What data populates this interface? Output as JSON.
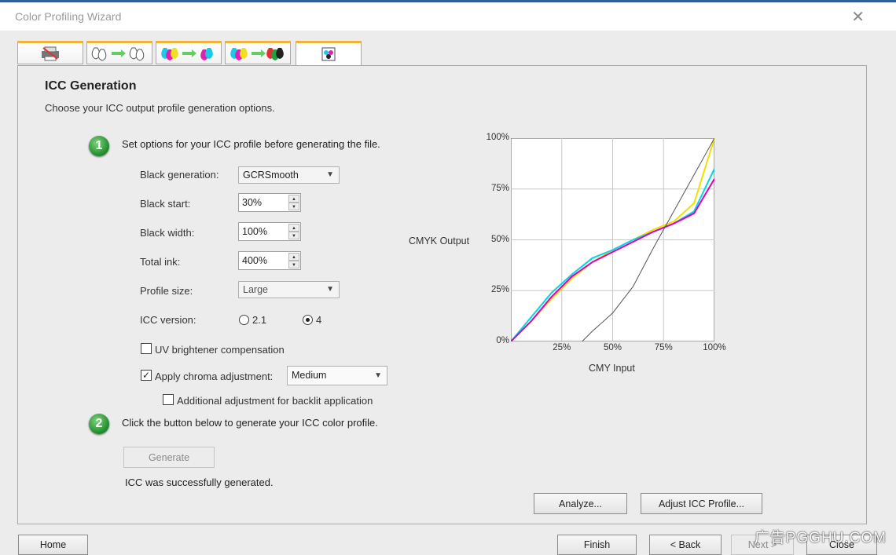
{
  "window": {
    "title": "Color Profiling Wizard"
  },
  "tabs": [
    {
      "icon": "printer-icon",
      "active": false
    },
    {
      "icon": "ink-to-ink-icon",
      "active": false
    },
    {
      "icon": "cmyk-to-ink-icon",
      "active": false
    },
    {
      "icon": "cmyk-to-cmyk-icon",
      "active": false
    },
    {
      "icon": "icc-profile-icon",
      "active": true
    }
  ],
  "header": {
    "title": "ICC Generation",
    "subtitle": "Choose your ICC output profile generation options."
  },
  "step1": {
    "number": "1",
    "text": "Set options for your ICC profile before generating the file."
  },
  "options": {
    "black_generation": {
      "label": "Black generation:",
      "value": "GCRSmooth"
    },
    "black_start": {
      "label": "Black start:",
      "value": "30%"
    },
    "black_width": {
      "label": "Black width:",
      "value": "100%"
    },
    "total_ink": {
      "label": "Total ink:",
      "value": "400%"
    },
    "profile_size": {
      "label": "Profile size:",
      "value": "Large"
    },
    "icc_version": {
      "label": "ICC version:",
      "options": [
        "2.1",
        "4"
      ],
      "selected": "4"
    },
    "uv_brightener": {
      "label": "UV brightener compensation",
      "checked": false
    },
    "chroma": {
      "label": "Apply chroma adjustment:",
      "checked": true,
      "value": "Medium"
    },
    "backlit": {
      "label": "Additional adjustment for backlit application",
      "checked": false
    }
  },
  "step2": {
    "number": "2",
    "text": "Click the button below to generate your ICC color profile."
  },
  "generate_label": "Generate",
  "status_text": "ICC was successfully generated.",
  "chart_data": {
    "type": "line",
    "xlabel": "CMY Input",
    "ylabel": "CMYK Output",
    "xticks": [
      "25%",
      "50%",
      "75%",
      "100%"
    ],
    "yticks": [
      "0%",
      "25%",
      "50%",
      "75%",
      "100%"
    ],
    "xlim": [
      0,
      100
    ],
    "ylim": [
      0,
      100
    ],
    "grid": true,
    "series": [
      {
        "color": "#f0e000",
        "x": [
          0,
          10,
          20,
          30,
          40,
          50,
          60,
          70,
          80,
          90,
          100
        ],
        "y": [
          0,
          10,
          21,
          31,
          39,
          45,
          50,
          55,
          59,
          68,
          100
        ]
      },
      {
        "color": "#00d8e8",
        "x": [
          0,
          10,
          20,
          30,
          40,
          50,
          60,
          70,
          80,
          90,
          100
        ],
        "y": [
          0,
          12,
          24,
          33,
          41,
          45,
          50,
          54,
          58,
          64,
          85
        ]
      },
      {
        "color": "#e000c0",
        "x": [
          0,
          10,
          20,
          30,
          40,
          50,
          60,
          70,
          80,
          90,
          100
        ],
        "y": [
          0,
          10,
          22,
          32,
          39,
          44,
          49,
          54,
          58,
          63,
          80
        ]
      },
      {
        "color": "#555555",
        "x": [
          0,
          10,
          20,
          30,
          35,
          40,
          50,
          60,
          70,
          80,
          90,
          100
        ],
        "y": [
          0,
          0,
          0,
          0,
          0,
          5,
          14,
          27,
          46,
          64,
          82,
          100
        ]
      }
    ]
  },
  "buttons": {
    "analyze": "Analyze...",
    "adjust_icc": "Adjust ICC Profile...",
    "home": "Home",
    "finish": "Finish",
    "back": "< Back",
    "next": "Next >",
    "close": "Close"
  },
  "watermark": "广告PGGHU.COM"
}
